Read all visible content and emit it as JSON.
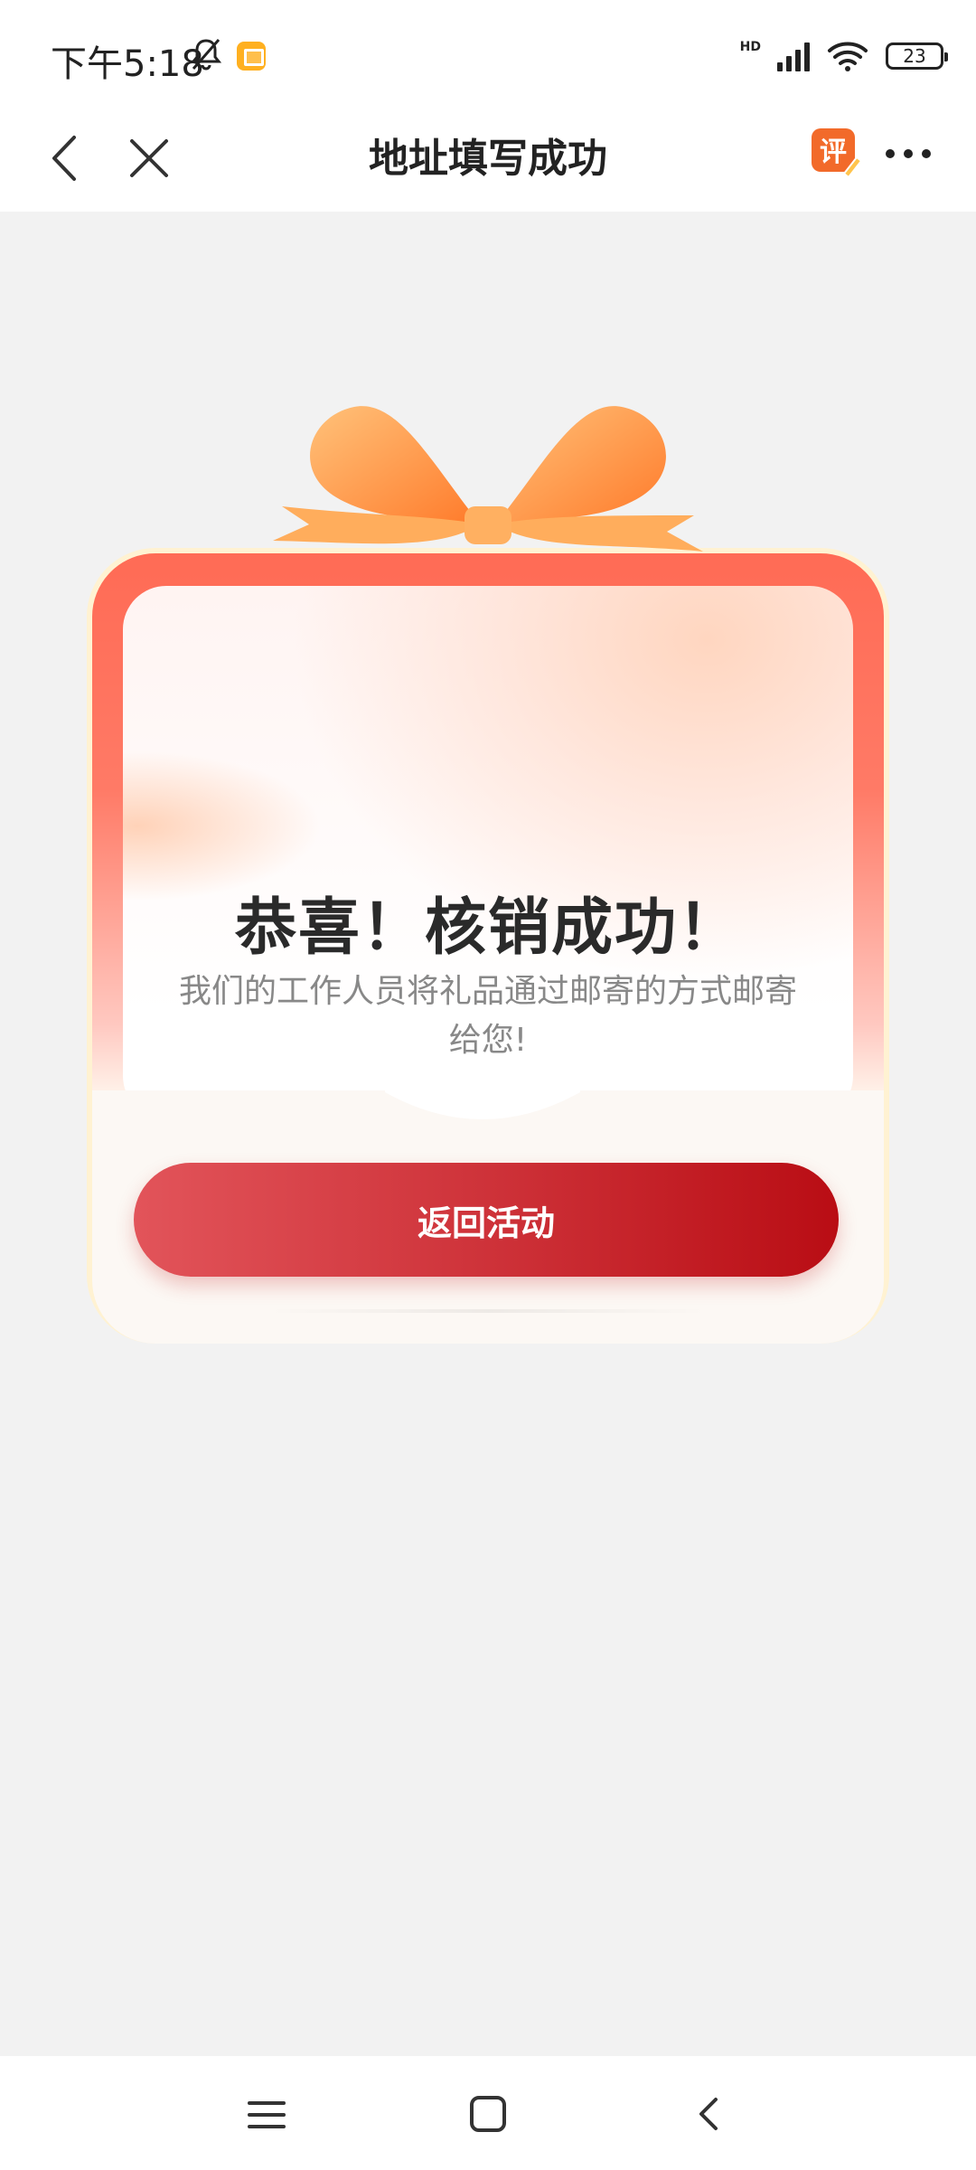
{
  "status_bar": {
    "time": "下午5:18",
    "network": "HD",
    "battery": "23"
  },
  "nav": {
    "title": "地址填写成功",
    "review_icon_label": "评"
  },
  "card": {
    "title": "恭喜！核销成功！",
    "description": "我们的工作人员将礼品通过邮寄的方式邮寄给您!",
    "button_label": "返回活动"
  },
  "colors": {
    "accent_red": "#c8232b",
    "ribbon_orange": "#ff9c3a",
    "page_bg": "#f2f2f2"
  }
}
